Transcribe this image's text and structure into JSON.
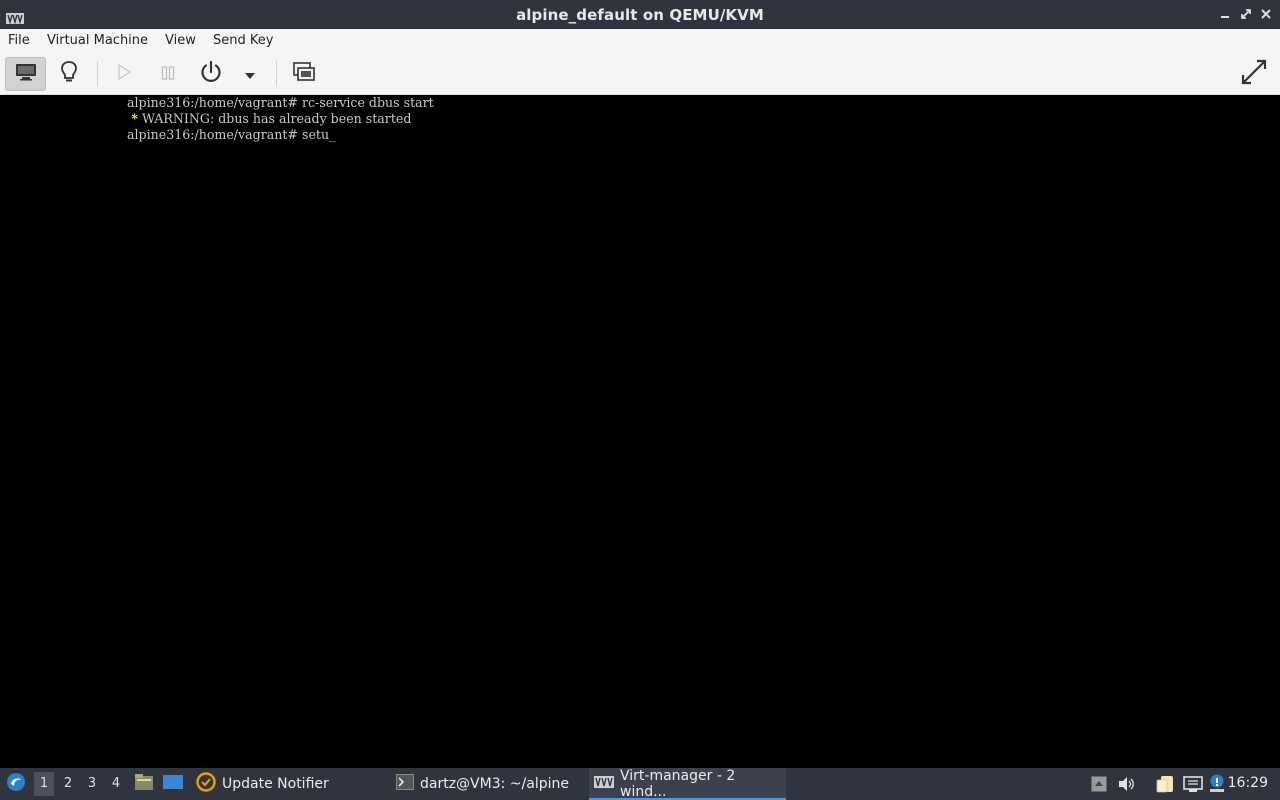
{
  "window": {
    "title": "alpine_default on QEMU/KVM",
    "controls": [
      "minimize-icon",
      "restore-icon",
      "close-icon"
    ]
  },
  "menubar": {
    "items": [
      "File",
      "Virtual Machine",
      "View",
      "Send Key"
    ]
  },
  "toolbar": {
    "buttons": [
      "console-icon",
      "lightbulb-details-icon",
      "run-icon",
      "pause-icon",
      "power-icon",
      "dropdown-arrow-icon",
      "snapshots-icon",
      "fullscreen-icon"
    ]
  },
  "console": {
    "line1": "alpine316:/home/vagrant# rc-service dbus start",
    "line2_star": " *",
    "line2_text": " WARNING: dbus has already been started",
    "line3": "alpine316:/home/vagrant# setu",
    "cursor": "_"
  },
  "taskbar": {
    "workspaces": [
      "1",
      "2",
      "3",
      "4"
    ],
    "active_workspace": "1",
    "tasks": [
      {
        "label": "Update Notifier",
        "icon": "update-notifier-icon"
      },
      {
        "label": "dartz@VM3: ~/alpine",
        "icon": "terminal-icon"
      },
      {
        "label": "Virt-manager - 2 wind...",
        "icon": "virt-manager-icon"
      }
    ],
    "clock": "16:29"
  },
  "colors": {
    "titlebar": "#2f343f",
    "menubar": "#f5f5f5",
    "console_bg": "#000000",
    "console_text": "#c8c8c8",
    "warning_star": "#e8e84a",
    "taskbar": "#2f343f",
    "accent": "#5294e2"
  }
}
